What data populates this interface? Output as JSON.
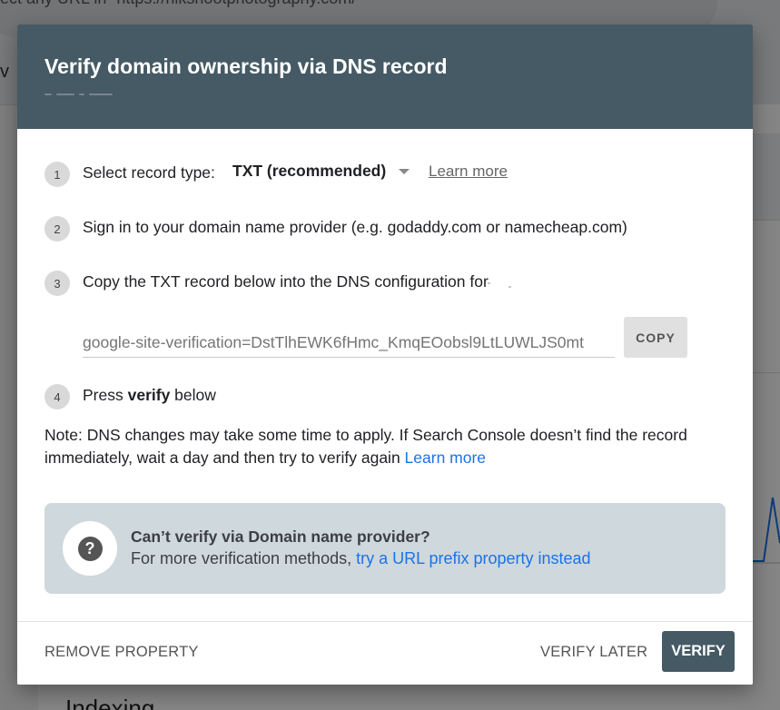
{
  "background": {
    "search_text": "ect any URL in “https://nikshootphotography.com/”",
    "partial_nav_letter": "v",
    "section_heading": "Indexing"
  },
  "dialog": {
    "title": "Verify domain ownership via DNS record",
    "steps": [
      {
        "number": "1",
        "text": "Select record type:"
      },
      {
        "number": "2",
        "text": "Sign in to your domain name provider (e.g. godaddy.com or namecheap.com)"
      },
      {
        "number": "3",
        "text": "Copy the TXT record below into the DNS configuration for"
      },
      {
        "number": "4",
        "text_before": "Press ",
        "text_bold": "verify",
        "text_after": " below"
      }
    ],
    "record_type": {
      "selected": "TXT (recommended)"
    },
    "learn_more_label": "Learn more",
    "txt_record_value": "google-site-verification=DstTlhEWK6fHmc_KmqEOobsl9LtLUWLJS0mt",
    "copy_label": "COPY",
    "note": {
      "text": "Note: DNS changes may take some time to apply. If Search Console doesn’t find the record immediately, wait a day and then try to verify again ",
      "link": "Learn more"
    },
    "callout": {
      "icon": "help-icon",
      "title": "Can’t verify via Domain name provider?",
      "body": "For more verification methods, ",
      "link": "try a URL prefix property instead"
    },
    "footer": {
      "remove_label": "REMOVE PROPERTY",
      "verify_later_label": "VERIFY LATER",
      "verify_label": "VERIFY"
    }
  },
  "colors": {
    "header_bg": "#455a64",
    "link_blue": "#1a73e8",
    "callout_bg": "#cfd8dc"
  }
}
